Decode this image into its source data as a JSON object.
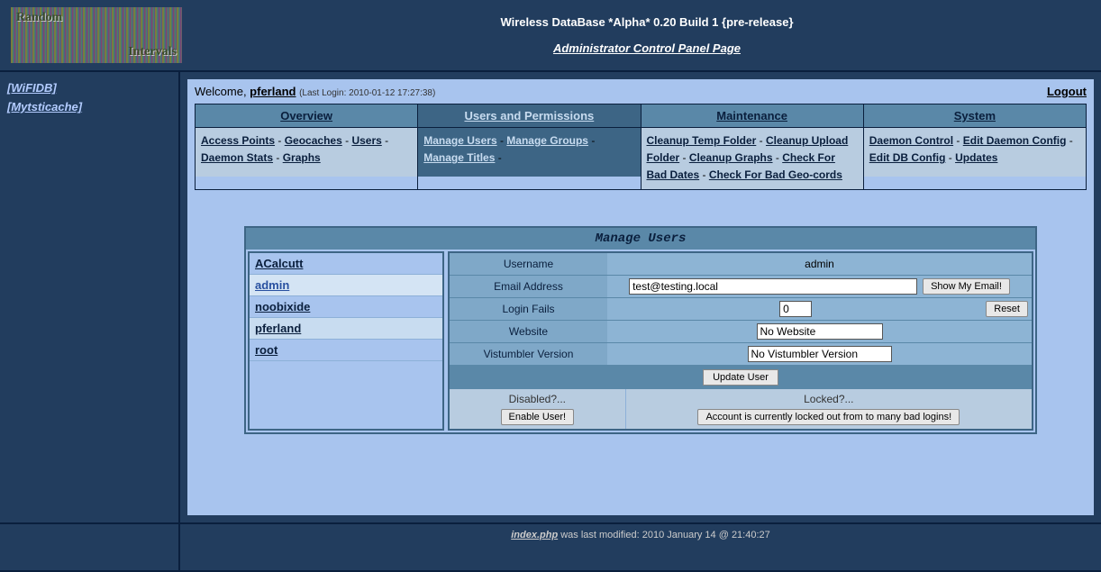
{
  "header": {
    "title": "Wireless DataBase *Alpha* 0.20 Build 1 {pre-release}",
    "subtitle": "Administrator Control Panel Page",
    "logo_top": "Random",
    "logo_bottom": "Intervals"
  },
  "sidebar": {
    "links": [
      "[WiFIDB]",
      "[Mytsticache]"
    ]
  },
  "welcome": {
    "prefix": "Welcome, ",
    "username": "pferland",
    "last_login": "(Last Login: 2010-01-12 17:27:38)",
    "logout": "Logout"
  },
  "tabs": {
    "overview": {
      "title": "Overview",
      "links": [
        "Access Points",
        "Geocaches",
        "Users",
        "Daemon Stats",
        "Graphs"
      ]
    },
    "users_perms": {
      "title": "Users and Permissions",
      "links": [
        "Manage Users",
        "Manage Groups",
        "Manage Titles"
      ]
    },
    "maintenance": {
      "title": "Maintenance",
      "links": [
        "Cleanup Temp Folder",
        "Cleanup Upload Folder",
        "Cleanup Graphs",
        "Check For Bad Dates",
        "Check For Bad Geo-cords"
      ]
    },
    "system": {
      "title": "System",
      "links": [
        "Daemon Control",
        "Edit Daemon Config",
        "Edit DB Config",
        "Updates"
      ]
    }
  },
  "panel": {
    "title": "Manage Users",
    "user_list": [
      "ACalcutt",
      "admin",
      "noobixide",
      "pferland",
      "root"
    ],
    "selected_user": "admin",
    "fields": {
      "username_label": "Username",
      "username_value": "admin",
      "email_label": "Email Address",
      "email_value": "test@testing.local",
      "show_email_btn": "Show My Email!",
      "fails_label": "Login Fails",
      "fails_value": "0",
      "reset_btn": "Reset",
      "website_label": "Website",
      "website_value": "No Website",
      "vist_label": "Vistumbler Version",
      "vist_value": "No Vistumbler Version",
      "update_btn": "Update User",
      "disabled_label": "Disabled?...",
      "enable_btn": "Enable User!",
      "locked_label": "Locked?...",
      "locked_btn": "Account is currently locked out from to many bad logins!"
    }
  },
  "footer": {
    "filename": "index.php",
    "text": " was last modified: 2010 January 14 @ 21:40:27"
  }
}
